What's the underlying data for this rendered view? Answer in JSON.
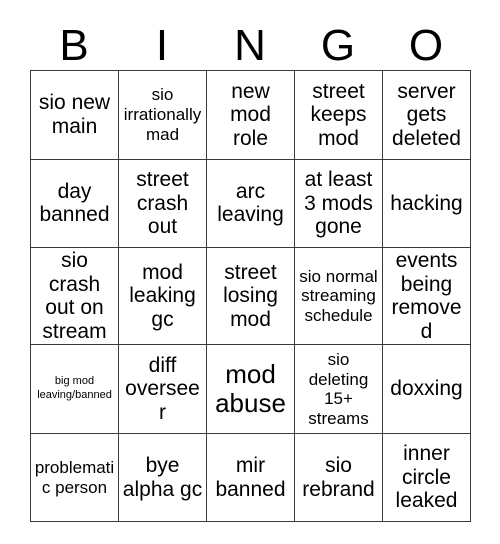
{
  "card": {
    "headers": [
      "B",
      "I",
      "N",
      "G",
      "O"
    ],
    "rows": [
      [
        {
          "text": "sio new main",
          "size": "md"
        },
        {
          "text": "sio irrationally mad",
          "size": "sm"
        },
        {
          "text": "new mod role",
          "size": "md"
        },
        {
          "text": "street keeps mod",
          "size": "md"
        },
        {
          "text": "server gets deleted",
          "size": "md"
        }
      ],
      [
        {
          "text": "day banned",
          "size": "md"
        },
        {
          "text": "street crash out",
          "size": "md"
        },
        {
          "text": "arc leaving",
          "size": "md"
        },
        {
          "text": "at least 3 mods gone",
          "size": "md"
        },
        {
          "text": "hacking",
          "size": "md"
        }
      ],
      [
        {
          "text": "sio crash out on stream",
          "size": "md"
        },
        {
          "text": "mod leaking gc",
          "size": "md"
        },
        {
          "text": "street losing mod",
          "size": "md"
        },
        {
          "text": "sio normal streaming schedule",
          "size": "sm"
        },
        {
          "text": "events being removed",
          "size": "md"
        }
      ],
      [
        {
          "text": "big mod leaving/banned",
          "size": "xs"
        },
        {
          "text": "diff overseer",
          "size": "md"
        },
        {
          "text": "mod abuse",
          "size": "lg"
        },
        {
          "text": "sio deleting 15+ streams",
          "size": "sm"
        },
        {
          "text": "doxxing",
          "size": "md"
        }
      ],
      [
        {
          "text": "problematic person",
          "size": "sm"
        },
        {
          "text": "bye alpha gc",
          "size": "md"
        },
        {
          "text": "mir banned",
          "size": "md"
        },
        {
          "text": "sio rebrand",
          "size": "md"
        },
        {
          "text": "inner circle leaked",
          "size": "md"
        }
      ]
    ]
  },
  "colors": {
    "background": "#ffffff",
    "text": "#000000",
    "border": "#3a3a3a"
  }
}
